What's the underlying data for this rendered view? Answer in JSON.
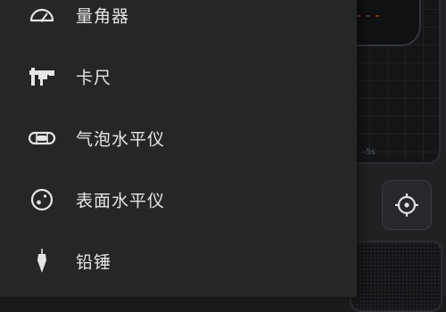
{
  "background": {
    "readout": "---",
    "tick_label": "-5s",
    "target_icon": "crosshair-icon"
  },
  "drawer": {
    "items": [
      {
        "label": "量角器",
        "icon": "protractor-icon"
      },
      {
        "label": "卡尺",
        "icon": "caliper-icon"
      },
      {
        "label": "气泡水平仪",
        "icon": "bubble-level-icon"
      },
      {
        "label": "表面水平仪",
        "icon": "surface-level-icon"
      },
      {
        "label": "铅锤",
        "icon": "plumb-bob-icon"
      }
    ]
  },
  "colors": {
    "drawer_bg": "#252628",
    "text": "#e6e6e6",
    "icon": "#e6e6e6",
    "readout": "#c0541e"
  }
}
